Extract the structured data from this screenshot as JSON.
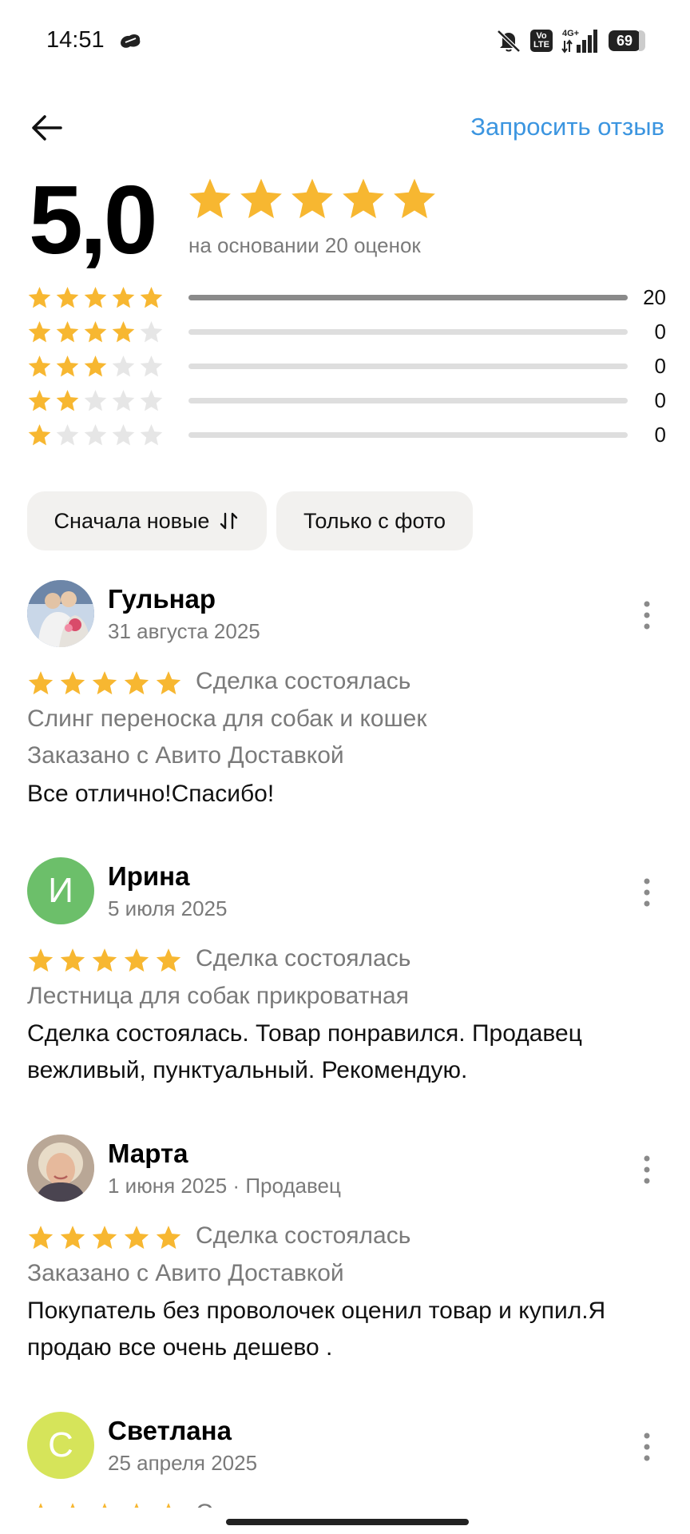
{
  "status_bar": {
    "time": "14:51",
    "volte": "Vo\nLTE",
    "network": "4G+",
    "battery": "69",
    "icons": [
      "cloud-icon",
      "mute-icon",
      "volte-icon",
      "signal-icon",
      "battery-icon"
    ]
  },
  "header": {
    "back_icon": "arrow-left-icon",
    "request_review": "Запросить отзыв"
  },
  "rating_summary": {
    "score": "5,0",
    "stars": 5,
    "based_on": "на основании 20 оценок",
    "histogram": [
      {
        "stars": 5,
        "count": "20",
        "fraction": 1.0
      },
      {
        "stars": 4,
        "count": "0",
        "fraction": 0
      },
      {
        "stars": 3,
        "count": "0",
        "fraction": 0
      },
      {
        "stars": 2,
        "count": "0",
        "fraction": 0
      },
      {
        "stars": 1,
        "count": "0",
        "fraction": 0
      }
    ]
  },
  "filters": {
    "sort": "Сначала новые",
    "sort_icon": "sort-arrows-icon",
    "only_photo": "Только с фото"
  },
  "reviews": [
    {
      "name": "Гульнар",
      "date": "31 августа 2025",
      "avatar": "photo",
      "stars": 5,
      "deal": "Сделка состоялась",
      "item": "Слинг переноска для собак и кошек",
      "delivery": "Заказано с Авито Доставкой",
      "text": "Все отлично!Спасибо!"
    },
    {
      "name": "Ирина",
      "date": "5 июля 2025",
      "avatar_letter": "И",
      "avatar_color": "#6cbf6a",
      "stars": 5,
      "deal": "Сделка состоялась",
      "item": "Лестница для собак прикроватная",
      "text": "Сделка состоялась. Товар понравился. Продавец вежливый, пунктуальный. Рекомендую."
    },
    {
      "name": "Марта",
      "date": "1 июня 2025 · Продавец",
      "avatar": "photo",
      "stars": 5,
      "deal": "Сделка состоялась",
      "delivery": "Заказано с Авито Доставкой",
      "text": "Покупатель без проволочек оценил товар и купил.Я продаю все очень дешево ."
    },
    {
      "name": "Светлана",
      "date": "25 апреля 2025",
      "avatar_letter": "С",
      "avatar_color": "#d6e45a",
      "stars": 5,
      "deal": "Сделка состоялась"
    }
  ],
  "colors": {
    "star": "#f7b731",
    "star_empty": "#e6e6e6",
    "link": "#3b95e0",
    "muted": "#7a7a7a"
  }
}
